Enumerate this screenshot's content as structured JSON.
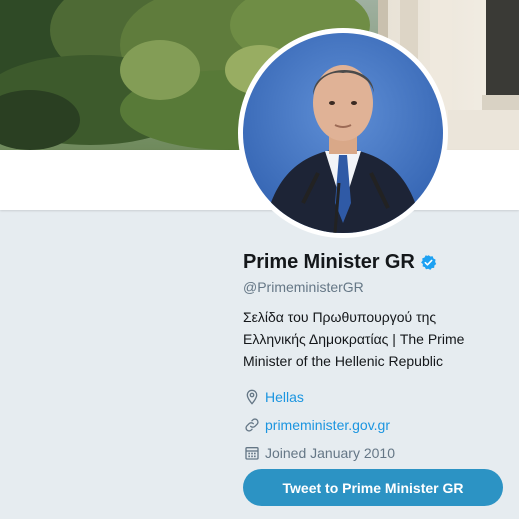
{
  "profile": {
    "name": "Prime Minister GR",
    "handle": "@PrimeministerGR",
    "bio_line1": "Σελίδα του Πρωθυπουργού της",
    "bio_line2": "Ελληνικής Δημοκρατίας | The Prime",
    "bio_line3": "Minister of the Hellenic Republic",
    "location": "Hellas",
    "website": "primeminister.gov.gr",
    "joined": "Joined January 2010",
    "verified": true
  },
  "actions": {
    "tweet_button": "Tweet to Prime Minister GR"
  },
  "icons": {
    "verified": "verified-badge-icon",
    "location": "location-pin-icon",
    "link": "link-icon",
    "calendar": "calendar-icon"
  },
  "colors": {
    "page_background": "#e6ecf0",
    "link": "#1b95e0",
    "verified": "#1da1f2",
    "button": "#2c93c4"
  }
}
